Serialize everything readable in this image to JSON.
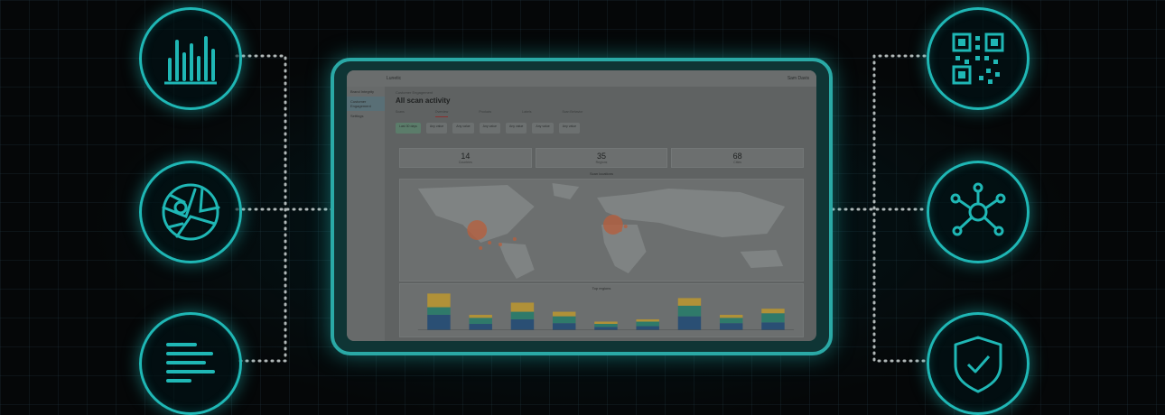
{
  "app": {
    "org_label": "Lunetic",
    "user_label": "Sam Davis",
    "nav_items": [
      "Brand Integrity",
      "Customer Engagement",
      "Settings"
    ],
    "breadcrumb": "Customer Engagement",
    "title": "All scan activity",
    "tabs": [
      "Scans",
      "Overview",
      "Products",
      "Labels",
      "Scan Behavior"
    ],
    "filters": [
      "Last 30 days",
      "Any value",
      "Any value",
      "Any value",
      "Any value",
      "Any value",
      "Any value"
    ],
    "stats": [
      {
        "value": "14",
        "label": "Countries"
      },
      {
        "value": "35",
        "label": "Regions"
      },
      {
        "value": "68",
        "label": "Cities"
      }
    ],
    "map_title": "Scan locations",
    "chart_title": "Top regions"
  },
  "colors": {
    "accent": "#1fb7b5",
    "screen": "#5f6262",
    "series_1": "#2a4f74",
    "series_2": "#2f7a6a",
    "series_3": "#b09138"
  },
  "icons": {
    "left": [
      "bar-chart-icon",
      "map-icon",
      "document-lines-icon"
    ],
    "right": [
      "qr-code-icon",
      "network-node-icon",
      "shield-check-icon"
    ]
  },
  "chart_data": {
    "type": "bar",
    "categories": [
      "Region A",
      "Region B",
      "Region C",
      "Region D",
      "Region E",
      "Region F",
      "Region G",
      "Region H",
      "Region I"
    ],
    "series": [
      {
        "values": [
          20,
          8,
          14,
          9,
          4,
          5,
          18,
          9,
          10
        ]
      },
      {
        "values": [
          10,
          8,
          10,
          9,
          4,
          6,
          14,
          7,
          12
        ]
      },
      {
        "values": [
          18,
          4,
          12,
          6,
          3,
          3,
          10,
          4,
          6
        ]
      }
    ],
    "ylim": [
      0,
      50
    ]
  }
}
